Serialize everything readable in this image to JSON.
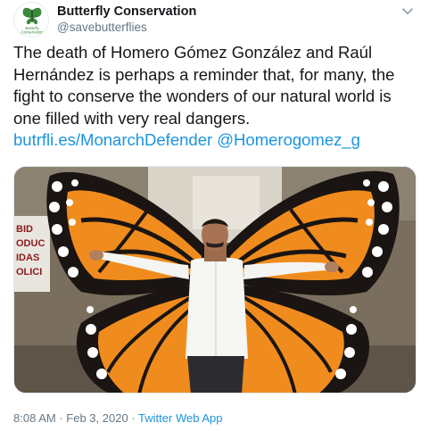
{
  "account": {
    "display_name": "Butterfly Conservation",
    "handle": "@savebutterflies",
    "avatar_label": "Butterfly Conservation"
  },
  "tweet": {
    "text": "The death of Homero Gómez González and Raúl Hernández is perhaps a reminder that, for many, the fight to conserve the wonders of our natural world is one filled with very real dangers.",
    "link": "butrfli.es/MonarchDefender",
    "mention": "@Homerogomez_g"
  },
  "media": {
    "description_icon": "photo-monarch-wings",
    "sign_fragments": [
      "BID",
      "ODUC",
      "IDAS",
      "OLICI"
    ]
  },
  "footer": {
    "time": "8:08 AM",
    "separator": "·",
    "date": "Feb 3, 2020",
    "app": "Twitter Web App"
  },
  "colors": {
    "link": "#1b95e0",
    "secondary": "#657786",
    "brand_green": "#3a8a3a",
    "wing_orange": "#f08c1e",
    "wing_black": "#1a1512"
  }
}
